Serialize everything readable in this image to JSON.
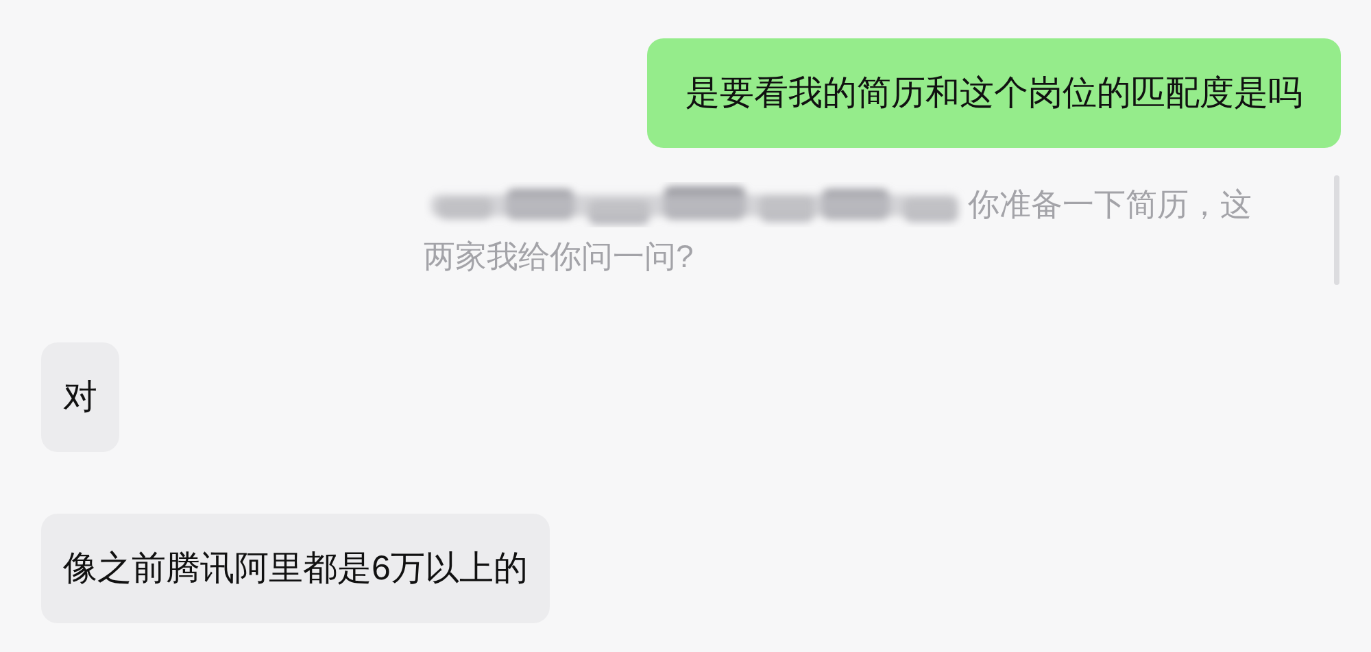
{
  "messages": [
    {
      "kind": "text",
      "outgoing": true,
      "text": "是要看我的简历和这个岗位的匹配度是吗"
    },
    {
      "kind": "quote",
      "outgoing": true,
      "redacted": true,
      "lines": [
        "你准备一下简历，这",
        "两家我给你问一问?"
      ]
    },
    {
      "kind": "text",
      "outgoing": false,
      "text": "对"
    },
    {
      "kind": "text",
      "outgoing": false,
      "text": "像之前腾讯阿里都是6万以上的"
    }
  ]
}
